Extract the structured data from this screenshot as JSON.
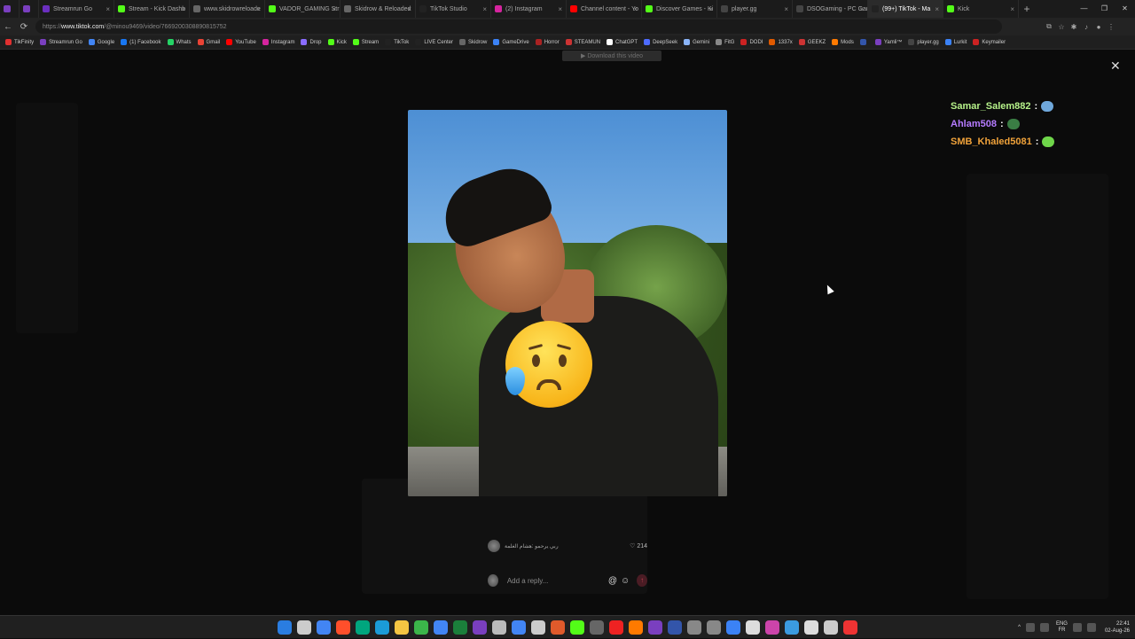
{
  "browser": {
    "tabs": [
      {
        "label": "",
        "color": "#7a3fbf",
        "small": true
      },
      {
        "label": "",
        "color": "#7a3fbf",
        "small": true
      },
      {
        "label": "Streamrun Go",
        "color": "#6b2fbf"
      },
      {
        "label": "Stream - Kick Dashb",
        "color": "#53fc18"
      },
      {
        "label": "www.skidrowreloade",
        "color": "#666666"
      },
      {
        "label": "VADOR_GAMING Str",
        "color": "#53fc18"
      },
      {
        "label": "Skidrow & Reloaded",
        "color": "#666666"
      },
      {
        "label": "TikTok Studio",
        "color": "#222222"
      },
      {
        "label": "(2) Instagram",
        "color": "#d6249f"
      },
      {
        "label": "Channel content - Yo",
        "color": "#ff0000"
      },
      {
        "label": "Discover Games - Ki",
        "color": "#53fc18"
      },
      {
        "label": "player.gg",
        "color": "#444444"
      },
      {
        "label": "DSOGaming - PC Gam",
        "color": "#444444"
      },
      {
        "label": "(99+) TikTok - Ma",
        "color": "#222222",
        "active": true
      },
      {
        "label": "Kick",
        "color": "#53fc18"
      }
    ],
    "url_prefix": "https://",
    "url_host": "www.tiktok.com",
    "url_path": "/@minou9469/video/7669200308890815752"
  },
  "bookmarks": [
    {
      "label": "TikFinity",
      "color": "#e03030"
    },
    {
      "label": "Streamrun Go",
      "color": "#7a3fbf"
    },
    {
      "label": "Google",
      "color": "#4285f4"
    },
    {
      "label": "(1) Facebook",
      "color": "#1877f2"
    },
    {
      "label": "Whats",
      "color": "#25d366"
    },
    {
      "label": "Gmail",
      "color": "#ea4335"
    },
    {
      "label": "YouTube",
      "color": "#ff0000"
    },
    {
      "label": "Instagram",
      "color": "#d6249f"
    },
    {
      "label": "Drop",
      "color": "#8a6cff"
    },
    {
      "label": "Kick",
      "color": "#53fc18"
    },
    {
      "label": "Stream",
      "color": "#53fc18"
    },
    {
      "label": "TikTok",
      "color": "#222222"
    },
    {
      "label": "LIVE Center",
      "color": "#222222"
    },
    {
      "label": "Skidrow",
      "color": "#666666"
    },
    {
      "label": "GameDrive",
      "color": "#3b82f6"
    },
    {
      "label": "Horror",
      "color": "#aa2222"
    },
    {
      "label": "STEAMUN",
      "color": "#cc3333"
    },
    {
      "label": "ChatGPT",
      "color": "#ffffff"
    },
    {
      "label": "DeepSeek",
      "color": "#4d6bfe"
    },
    {
      "label": "Gemini",
      "color": "#8ab4f8"
    },
    {
      "label": "FitG",
      "color": "#888888"
    },
    {
      "label": "DODI",
      "color": "#cc2222"
    },
    {
      "label": "1337x",
      "color": "#e05a00"
    },
    {
      "label": "GEEKZ",
      "color": "#cc3333"
    },
    {
      "label": "Mods",
      "color": "#ff7a00"
    },
    {
      "label": "",
      "color": "#3355aa"
    },
    {
      "label": "Yamli™",
      "color": "#7a3fbf"
    },
    {
      "label": "player.gg",
      "color": "#444444"
    },
    {
      "label": "Lurkit",
      "color": "#3b82f6"
    },
    {
      "label": "Keymailer",
      "color": "#cc2222"
    }
  ],
  "viewer": {
    "download_banner": "▶ Download this video"
  },
  "chat": [
    {
      "user": "Samar_Salem882",
      "color": "#b6f28a",
      "emoji_color": "#6fa8dc"
    },
    {
      "user": "Ahlam508",
      "color": "#b57bff",
      "emoji_color": "#3a7d44"
    },
    {
      "user": "SMB_Khaled5081",
      "color": "#f0a23a",
      "emoji_color": "#6fd64a"
    }
  ],
  "comment": {
    "author_text": "ربي يرحمو :هشام الغلمة",
    "likes": "214"
  },
  "reply": {
    "placeholder": "Add a reply..."
  },
  "taskbar": {
    "lang1": "ENG",
    "lang2": "FR",
    "time": "22:41",
    "date": "02-Aug-26",
    "icon_colors": [
      "#2a7de1",
      "#cccccc",
      "#4285f4",
      "#ff4f2b",
      "#00a67e",
      "#1b9bd7",
      "#f4c542",
      "#3bb54a",
      "#4285f4",
      "#1b7f3b",
      "#7a3fbf",
      "#bbbbbb",
      "#4285f4",
      "#cccccc",
      "#e05a2b",
      "#53fc18",
      "#666666",
      "#ee2222",
      "#ff7a00",
      "#7a3fbf",
      "#3355aa",
      "#888888",
      "#888888",
      "#3b82f6",
      "#dddddd",
      "#cc44aa",
      "#3b9be0",
      "#dddddd",
      "#cccccc",
      "#ee3333"
    ]
  }
}
